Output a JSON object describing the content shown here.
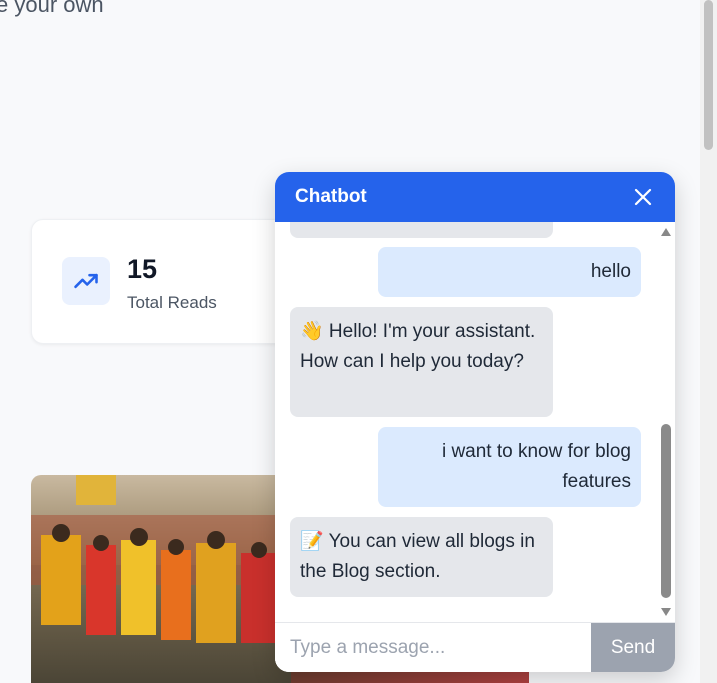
{
  "hero": {
    "text": "e your own"
  },
  "stats": {
    "value": "15",
    "label": "Total Reads",
    "icon": "trending-up-icon"
  },
  "chatbot": {
    "title": "Chatbot",
    "close_icon": "close-icon",
    "messages": [
      {
        "role": "bot",
        "text": ""
      },
      {
        "role": "user",
        "text": "hello"
      },
      {
        "role": "bot",
        "text": "👋 Hello! I'm your assistant. How can I help you today?"
      },
      {
        "role": "user",
        "text": "i want to know for blog features"
      },
      {
        "role": "bot",
        "text": "📝 You can view all blogs in the Blog section."
      }
    ],
    "input_placeholder": "Type a message...",
    "input_value": "",
    "send_label": "Send"
  },
  "colors": {
    "accent": "#2563eb",
    "user_bubble": "#dbeafe",
    "bot_bubble": "#e5e7eb",
    "send_disabled": "#9ca3af"
  }
}
